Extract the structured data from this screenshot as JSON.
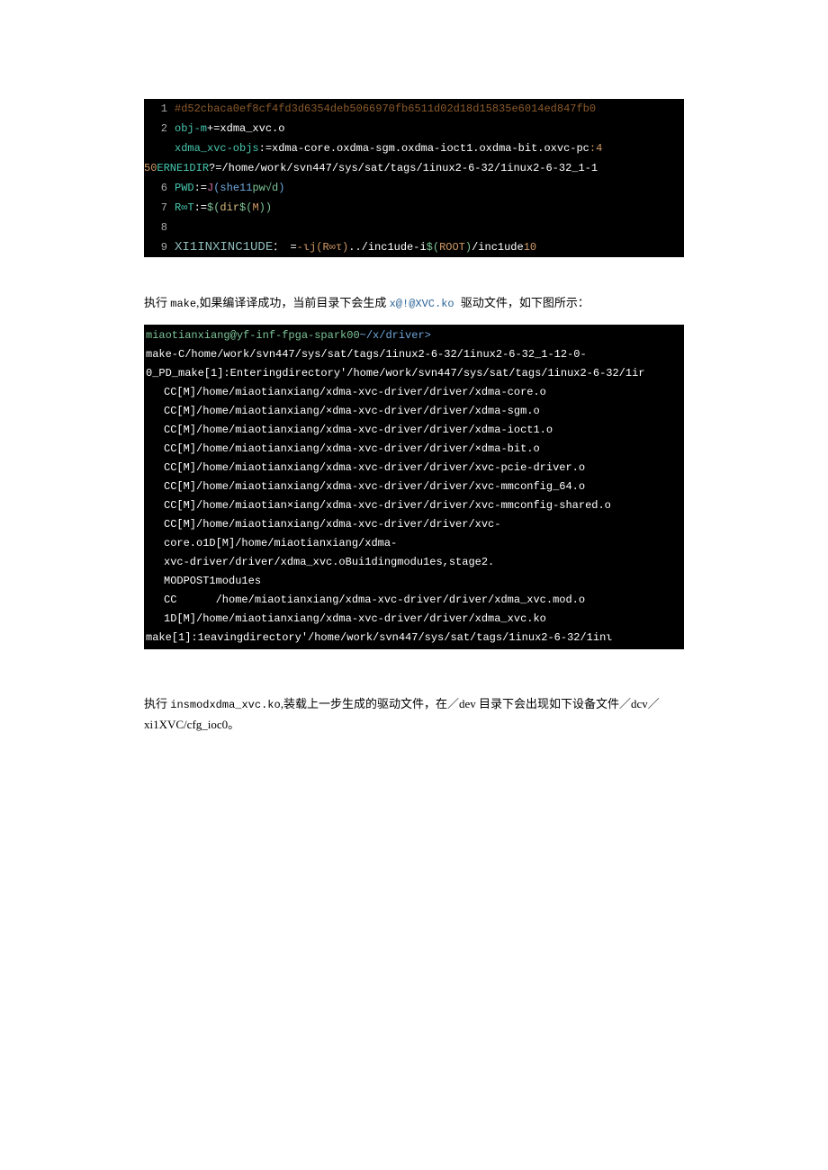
{
  "code1": {
    "ln1": "1",
    "ln1_text": "#d52cbaca0ef8cf4fd3d6354deb5066970fb6511d02d18d15835e6014ed847fb0",
    "ln2": "2",
    "ln2_a": "obj-m",
    "ln2_b": "+=xdma_xvc.o",
    "ln3_cont_a": "xdma_xvc-objs",
    "ln3_cont_b": ":=xdma-core.oxdma-sgm.oxdma-ioct1.oxdma-bit.oxvc-pc",
    "ln3_cont_c": ":4",
    "ln50_a": "50",
    "ln50_b": "ERNE1DIR",
    "ln50_c": "?=/home/work/svn447/sys/sat/tags/1inux2-6-32/1inux2-6-32_1-1",
    "ln6": "6",
    "ln6_a": "PWD",
    "ln6_b": ":=",
    "ln6_c": "J",
    "ln6_d": "(she11",
    "ln6_e": "pw√d",
    "ln6_f": ")",
    "ln7": "7",
    "ln7_a": "R∞T",
    "ln7_b": ":=",
    "ln7_c": "$(",
    "ln7_d": "dir",
    "ln7_e": "$(",
    "ln7_f": "M",
    "ln7_g": "))",
    "ln8": "8",
    "ln9": "9",
    "ln9_a": "XI1INXINC1UDE",
    "ln9_b": "：",
    "ln9_c": "=",
    "ln9_d": "-ιj(R∞τ)",
    "ln9_e": "../inc1ude-i",
    "ln9_f": "$(",
    "ln9_g": "ROOT",
    "ln9_h": ")",
    "ln9_i": "/inc1ude",
    "ln9_j": "10"
  },
  "para1": {
    "pre": "执行 ",
    "make": "make",
    "mid": ",如果编译译成功，当前目录下会生成 ",
    "file": "x@!@XVC.ko ",
    "post": "驱动文件，如下图所示："
  },
  "term": {
    "l1_a": "miaotianxiang@yf-inf-fpga-spark00",
    "l1_b": "~/x/driver>",
    "l2": "make-C/home/work/svn447/sys/sat/tags/1inux2-6-32/1inux2-6-32_1-12-0-",
    "l3": "0_PD_make[1]:Enteringdirectory'/home/work/svn447/sys/sat/tags/1inux2-6-32/1ir",
    "l4": "CC[M]/home/miaotianxiang/xdma-xvc-driver/driver/xdma-core.o",
    "l5": "CC[M]/home/miaotianxiang/×dma-xvc-driver/driver/xdma-sgm.o",
    "l6": "CC[M]/home/miaotianxiang/xdma-xvc-driver/driver/xdma-ioct1.o",
    "l7": "CC[M]/home/miaotianxiang/xdma-xvc-driver/driver/×dma-bit.o",
    "l8": "CC[M]/home/miaotianxiang/xdma-xvc-driver/driver/xvc-pcie-driver.o",
    "l9": "CC[M]/home/miaotianxiang/xdma-xvc-driver/driver/xvc-mmconfig_64.o",
    "l10": "CC[M]/home/miaotian×iang/xdma-xvc-driver/driver/xvc-mmconfig-shared.o",
    "l11": "CC[M]/home/miaotianxiang/xdma-xvc-driver/driver/xvc-core.o1D[M]/home/miaotianxiang/xdma-",
    "l12": "xvc-driver/driver/xdma_xvc.oBui1dingmodu1es,stage2.",
    "l13": "MODPOST1modu1es",
    "l14": "CC      /home/miaotianxiang/xdma-xvc-driver/driver/xdma_xvc.mod.o",
    "l15": "1D[M]/home/miaotianxiang/xdma-xvc-driver/driver/xdma_xvc.ko",
    "l16": "make[1]:1eavingdirectory'/home/work/svn447/sys/sat/tags/1inux2-6-32/1inι"
  },
  "para2": {
    "pre": "执行 ",
    "cmd": "insmodxdma_xvc.ko",
    "mid": ",装载上一步生成的驱动文件，在／dev 目录下会出现如下设备文件／dcv／xi1XVC/cfg_ioc0。"
  }
}
